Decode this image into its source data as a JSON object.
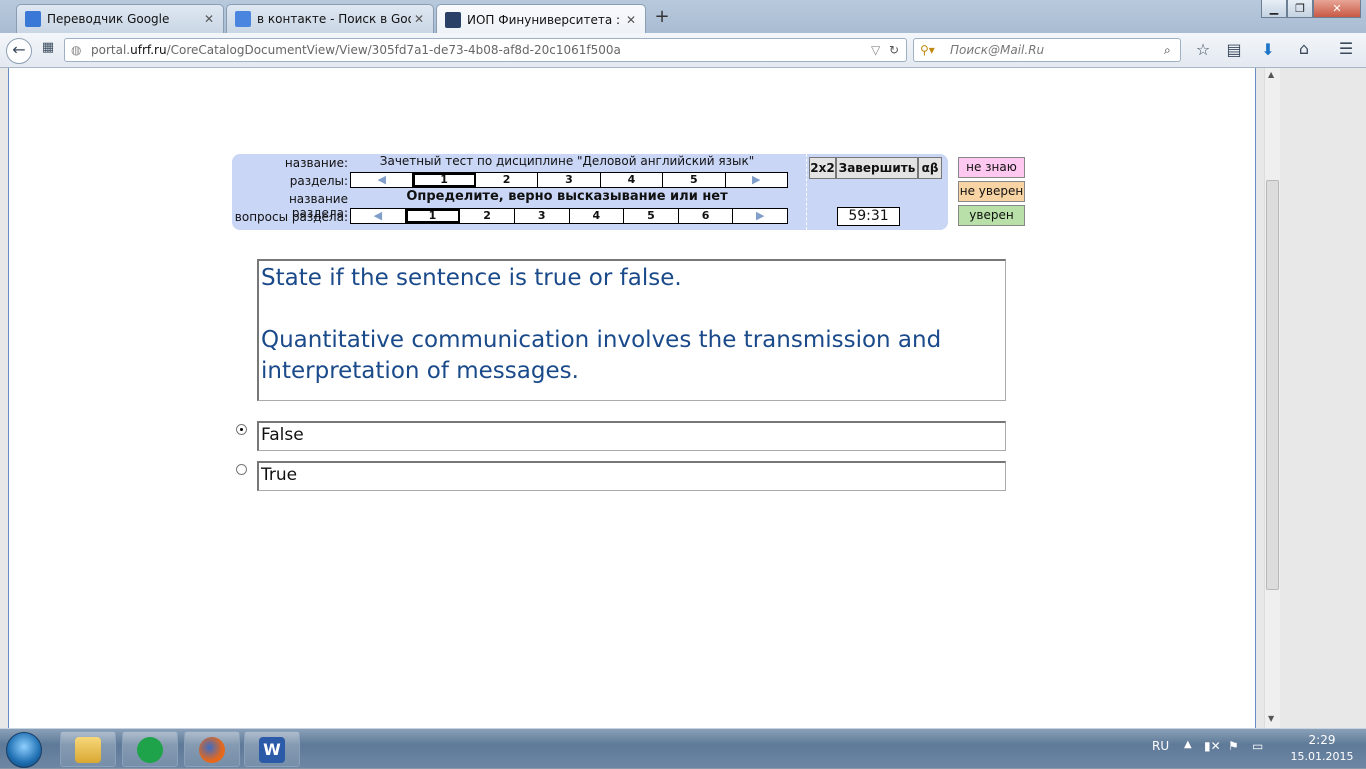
{
  "browser": {
    "tabs": [
      {
        "label": "Переводчик Google",
        "active": false,
        "icon_color": "#3a78d8"
      },
      {
        "label": "в контакте - Поиск в Goo...",
        "active": false,
        "icon_color": "#4a86e0"
      },
      {
        "label": "ИОП Финуниверситета : ...",
        "active": true,
        "icon_color": "#2a4066"
      }
    ],
    "new_tab": "+",
    "url_prefix": "portal.",
    "url_domain": "ufrf.ru",
    "url_path": "/CoreCatalogDocumentView/View/305fd7a1-de73-4b08-af8d-20c1061f500a",
    "search_placeholder": "Поиск@Mail.Ru"
  },
  "test": {
    "labels": {
      "name": "название:",
      "sections": "разделы:",
      "section_name": "название раздела:",
      "section_questions": "вопросы раздела:"
    },
    "title": "Зачетный тест по дисциплине \"Деловой английский язык\"",
    "sections": [
      "1",
      "2",
      "3",
      "4",
      "5"
    ],
    "selected_section": "1",
    "section_title": "Определите, верно высказывание или нет",
    "questions": [
      "1",
      "2",
      "3",
      "4",
      "5",
      "6"
    ],
    "selected_question": "1",
    "buttons": {
      "calc": "2x2",
      "finish": "Завершить",
      "alpha": "αβ"
    },
    "timer": "59:31",
    "confidence": [
      {
        "label": "не знаю",
        "color": "#ffc8f0"
      },
      {
        "label": "не уверен",
        "color": "#f8d4a4"
      },
      {
        "label": "уверен",
        "color": "#b8e0a8"
      }
    ]
  },
  "question": {
    "line1": "State if the sentence is true or false.",
    "line2": "Quantitative communication involves the transmission and",
    "line3": "interpretation of messages."
  },
  "answers": [
    {
      "label": "False",
      "selected": true
    },
    {
      "label": "True",
      "selected": false
    }
  ],
  "taskbar": {
    "language": "RU",
    "time": "2:29",
    "date": "15.01.2015"
  }
}
